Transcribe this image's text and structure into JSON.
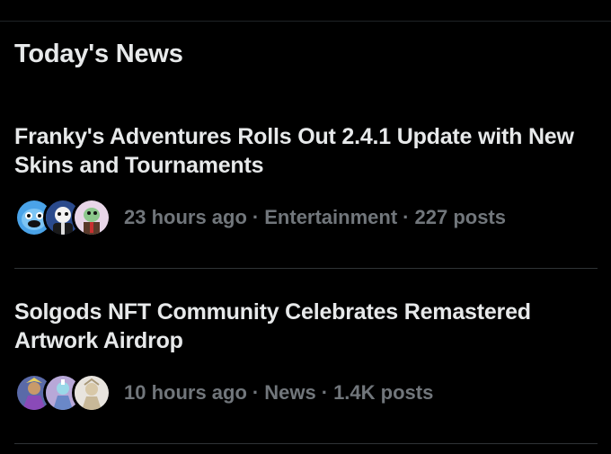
{
  "section": {
    "title": "Today's News"
  },
  "items": [
    {
      "headline": "Franky's Adventures Rolls Out 2.4.1 Update with New Skins and Tournaments",
      "time": "23 hours ago",
      "category": "Entertainment",
      "posts": "227 posts",
      "separator": "·",
      "avatar_colors": [
        "#4aa3e8",
        "#2a4a8c",
        "#e8d6e8"
      ]
    },
    {
      "headline": "Solgods NFT Community Celebrates Remastered Artwork Airdrop",
      "time": "10 hours ago",
      "category": "News",
      "posts": "1.4K posts",
      "separator": "·",
      "avatar_colors": [
        "#5a6aa8",
        "#b8a8d8",
        "#e8e4de"
      ]
    }
  ]
}
